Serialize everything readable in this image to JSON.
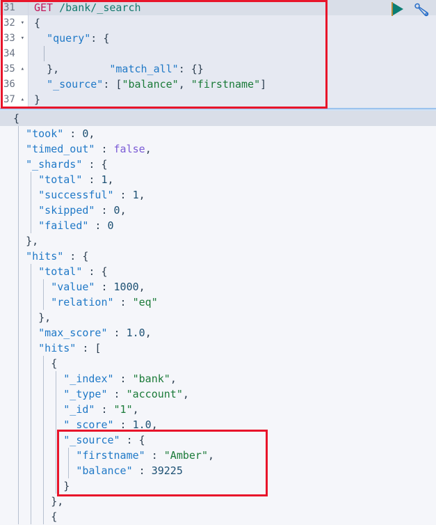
{
  "app": {
    "name": "kibana-dev-tools-console"
  },
  "request_editor": {
    "line_numbers": [
      "31",
      "32",
      "33",
      "34",
      "35",
      "36",
      "37"
    ],
    "fold_markers": [
      "",
      "▾",
      "▾",
      "",
      "▴",
      "",
      "▴"
    ],
    "request_line": {
      "method": "GET",
      "path": "/bank/_search"
    },
    "body_lines": [
      {
        "indent": "",
        "text": "{"
      },
      {
        "indent": "  ",
        "key": "\"query\"",
        "rest": ": {"
      },
      {
        "indent": "    ",
        "key": "\"match_all\"",
        "rest": ": {}"
      },
      {
        "indent": "  ",
        "text": "},"
      },
      {
        "indent": "  ",
        "key": "\"_source\"",
        "rest": ": [",
        "arr": [
          "\"balance\"",
          "\"firstname\""
        ],
        "tail": "]"
      },
      {
        "indent": "",
        "text": "}"
      }
    ],
    "raw_body": "{\n  \"query\": {\n    \"match_all\": {}\n  },\n  \"_source\": [\"balance\", \"firstname\"]\n}"
  },
  "toolbar": {
    "play_label": "play-triangle",
    "play_title": "Click to send request",
    "wrench_label": "wrench",
    "wrench_title": "Open documentation / auto indent"
  },
  "response_viewer": {
    "lines": [
      {
        "i": 0,
        "active": true,
        "pad": 1,
        "segs": [
          {
            "t": "{",
            "c": "r-p"
          }
        ]
      },
      {
        "i": 1,
        "active": false,
        "pad": 2,
        "segs": [
          {
            "t": "\"took\"",
            "c": "r-key"
          },
          {
            "t": " : ",
            "c": "r-p"
          },
          {
            "t": "0",
            "c": "r-num"
          },
          {
            "t": ",",
            "c": "r-p"
          }
        ]
      },
      {
        "i": 2,
        "active": false,
        "pad": 2,
        "segs": [
          {
            "t": "\"timed_out\"",
            "c": "r-key"
          },
          {
            "t": " : ",
            "c": "r-p"
          },
          {
            "t": "false",
            "c": "r-bool"
          },
          {
            "t": ",",
            "c": "r-p"
          }
        ]
      },
      {
        "i": 3,
        "active": false,
        "pad": 2,
        "segs": [
          {
            "t": "\"_shards\"",
            "c": "r-key"
          },
          {
            "t": " : {",
            "c": "r-p"
          }
        ]
      },
      {
        "i": 4,
        "active": false,
        "pad": 3,
        "segs": [
          {
            "t": "\"total\"",
            "c": "r-key"
          },
          {
            "t": " : ",
            "c": "r-p"
          },
          {
            "t": "1",
            "c": "r-num"
          },
          {
            "t": ",",
            "c": "r-p"
          }
        ]
      },
      {
        "i": 5,
        "active": false,
        "pad": 3,
        "segs": [
          {
            "t": "\"successful\"",
            "c": "r-key"
          },
          {
            "t": " : ",
            "c": "r-p"
          },
          {
            "t": "1",
            "c": "r-num"
          },
          {
            "t": ",",
            "c": "r-p"
          }
        ]
      },
      {
        "i": 6,
        "active": false,
        "pad": 3,
        "segs": [
          {
            "t": "\"skipped\"",
            "c": "r-key"
          },
          {
            "t": " : ",
            "c": "r-p"
          },
          {
            "t": "0",
            "c": "r-num"
          },
          {
            "t": ",",
            "c": "r-p"
          }
        ]
      },
      {
        "i": 7,
        "active": false,
        "pad": 3,
        "segs": [
          {
            "t": "\"failed\"",
            "c": "r-key"
          },
          {
            "t": " : ",
            "c": "r-p"
          },
          {
            "t": "0",
            "c": "r-num"
          }
        ]
      },
      {
        "i": 8,
        "active": false,
        "pad": 2,
        "segs": [
          {
            "t": "},",
            "c": "r-p"
          }
        ]
      },
      {
        "i": 9,
        "active": false,
        "pad": 2,
        "segs": [
          {
            "t": "\"hits\"",
            "c": "r-key"
          },
          {
            "t": " : {",
            "c": "r-p"
          }
        ]
      },
      {
        "i": 10,
        "active": false,
        "pad": 3,
        "segs": [
          {
            "t": "\"total\"",
            "c": "r-key"
          },
          {
            "t": " : {",
            "c": "r-p"
          }
        ]
      },
      {
        "i": 11,
        "active": false,
        "pad": 4,
        "segs": [
          {
            "t": "\"value\"",
            "c": "r-key"
          },
          {
            "t": " : ",
            "c": "r-p"
          },
          {
            "t": "1000",
            "c": "r-num"
          },
          {
            "t": ",",
            "c": "r-p"
          }
        ]
      },
      {
        "i": 12,
        "active": false,
        "pad": 4,
        "segs": [
          {
            "t": "\"relation\"",
            "c": "r-key"
          },
          {
            "t": " : ",
            "c": "r-p"
          },
          {
            "t": "\"eq\"",
            "c": "r-str"
          }
        ]
      },
      {
        "i": 13,
        "active": false,
        "pad": 3,
        "segs": [
          {
            "t": "},",
            "c": "r-p"
          }
        ]
      },
      {
        "i": 14,
        "active": false,
        "pad": 3,
        "segs": [
          {
            "t": "\"max_score\"",
            "c": "r-key"
          },
          {
            "t": " : ",
            "c": "r-p"
          },
          {
            "t": "1.0",
            "c": "r-num"
          },
          {
            "t": ",",
            "c": "r-p"
          }
        ]
      },
      {
        "i": 15,
        "active": false,
        "pad": 3,
        "segs": [
          {
            "t": "\"hits\"",
            "c": "r-key"
          },
          {
            "t": " : [",
            "c": "r-p"
          }
        ]
      },
      {
        "i": 16,
        "active": false,
        "pad": 4,
        "segs": [
          {
            "t": "{",
            "c": "r-p"
          }
        ]
      },
      {
        "i": 17,
        "active": false,
        "pad": 5,
        "segs": [
          {
            "t": "\"_index\"",
            "c": "r-key"
          },
          {
            "t": " : ",
            "c": "r-p"
          },
          {
            "t": "\"bank\"",
            "c": "r-str"
          },
          {
            "t": ",",
            "c": "r-p"
          }
        ]
      },
      {
        "i": 18,
        "active": false,
        "pad": 5,
        "segs": [
          {
            "t": "\"_type\"",
            "c": "r-key"
          },
          {
            "t": " : ",
            "c": "r-p"
          },
          {
            "t": "\"account\"",
            "c": "r-str"
          },
          {
            "t": ",",
            "c": "r-p"
          }
        ]
      },
      {
        "i": 19,
        "active": false,
        "pad": 5,
        "segs": [
          {
            "t": "\"_id\"",
            "c": "r-key"
          },
          {
            "t": " : ",
            "c": "r-p"
          },
          {
            "t": "\"1\"",
            "c": "r-str"
          },
          {
            "t": ",",
            "c": "r-p"
          }
        ]
      },
      {
        "i": 20,
        "active": false,
        "pad": 5,
        "segs": [
          {
            "t": "\"_score\"",
            "c": "r-key"
          },
          {
            "t": " : ",
            "c": "r-p"
          },
          {
            "t": "1.0",
            "c": "r-num"
          },
          {
            "t": ",",
            "c": "r-p"
          }
        ]
      },
      {
        "i": 21,
        "active": false,
        "pad": 5,
        "segs": [
          {
            "t": "\"_source\"",
            "c": "r-key"
          },
          {
            "t": " : {",
            "c": "r-p"
          }
        ]
      },
      {
        "i": 22,
        "active": false,
        "pad": 6,
        "segs": [
          {
            "t": "\"firstname\"",
            "c": "r-key"
          },
          {
            "t": " : ",
            "c": "r-p"
          },
          {
            "t": "\"Amber\"",
            "c": "r-str"
          },
          {
            "t": ",",
            "c": "r-p"
          }
        ]
      },
      {
        "i": 23,
        "active": false,
        "pad": 6,
        "segs": [
          {
            "t": "\"balance\"",
            "c": "r-key"
          },
          {
            "t": " : ",
            "c": "r-p"
          },
          {
            "t": "39225",
            "c": "r-num"
          }
        ]
      },
      {
        "i": 24,
        "active": false,
        "pad": 5,
        "segs": [
          {
            "t": "}",
            "c": "r-p"
          }
        ]
      },
      {
        "i": 25,
        "active": false,
        "pad": 4,
        "segs": [
          {
            "t": "},",
            "c": "r-p"
          }
        ]
      },
      {
        "i": 26,
        "active": false,
        "pad": 4,
        "segs": [
          {
            "t": "{",
            "c": "r-p"
          }
        ]
      }
    ],
    "values": {
      "took": 0,
      "timed_out": false,
      "shards_total": 1,
      "shards_successful": 1,
      "shards_skipped": 0,
      "shards_failed": 0,
      "hits_total_value": 1000,
      "hits_total_relation": "eq",
      "max_score": 1.0,
      "first_hit_index": "bank",
      "first_hit_type": "account",
      "first_hit_id": "1",
      "first_hit_score": 1.0,
      "first_hit_firstname": "Amber",
      "first_hit_balance": 39225
    }
  },
  "annotations": [
    {
      "name": "request-highlight",
      "target": "request editor with GET /bank/_search and body"
    },
    {
      "name": "source-highlight",
      "target": "_source object of first hit"
    }
  ],
  "colors": {
    "editor_bg": "#e6e9f2",
    "editor_head_bg": "#d9dee8",
    "response_bg": "#f5f6fa",
    "gutter_bg": "#ffffff",
    "annotation_red": "#e8142a",
    "method_pink": "#c2185b",
    "url_teal": "#13786d",
    "key_blue": "#2079c7",
    "string_green": "#1a7a38",
    "number_navy": "#1b4f72",
    "bool_purple": "#7b5bd6",
    "play_green": "#0a7d73",
    "wrench_blue": "#2a6fc9",
    "divider_blue": "#7fb2e8"
  }
}
